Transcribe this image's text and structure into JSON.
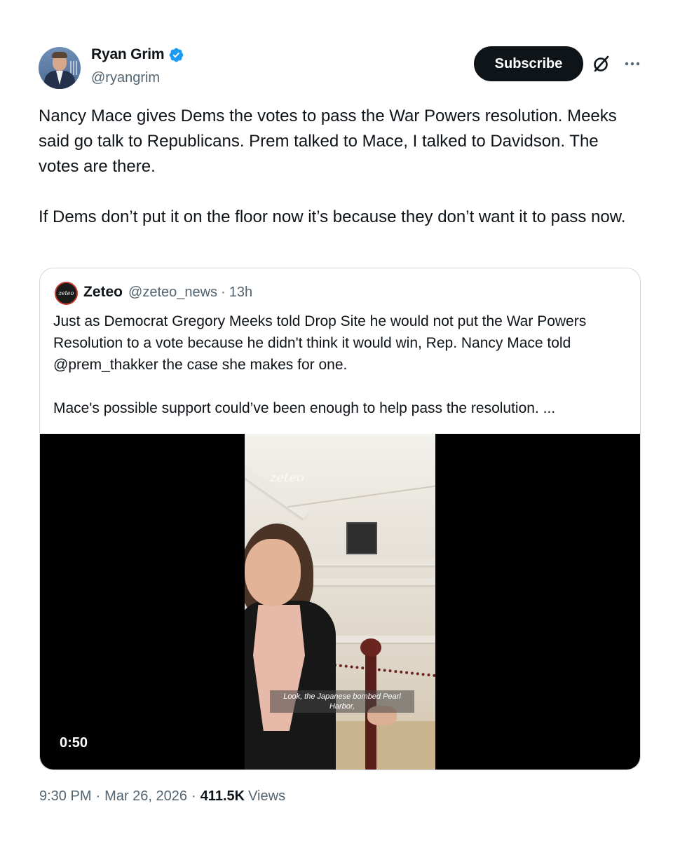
{
  "author": {
    "display_name": "Ryan Grim",
    "handle": "@ryangrim",
    "verified": true,
    "verified_color": "#1d9bf0"
  },
  "actions": {
    "subscribe_label": "Subscribe",
    "grok_icon": "grok-icon",
    "more_icon": "more-horizontal-icon"
  },
  "tweet": {
    "text": "Nancy Mace gives Dems the votes to pass the War Powers resolution. Meeks said go talk to Republicans. Prem talked to Mace, I talked to Davidson. The votes are there.\n\nIf Dems don’t put it on the floor now it’s because they don’t want it to pass now."
  },
  "quote": {
    "avatar_text": "zeteo",
    "name": "Zeteo",
    "handle": "@zeteo_news",
    "separator": "·",
    "time": "13h",
    "text": "Just as Democrat Gregory Meeks told Drop Site he would not put the War Powers Resolution to a vote because he didn't think it would win, Rep. Nancy Mace told @prem_thakker the case she makes for one.\n\nMace's possible support could’ve been enough to help pass the resolution.  ...",
    "video": {
      "watermark": "zeteo",
      "caption": "Look, the Japanese bombed Pearl Harbor,",
      "duration": "0:50"
    }
  },
  "footer": {
    "time": "9:30 PM",
    "separator": "·",
    "date": "Mar 26, 2026",
    "views_count": "411.5K",
    "views_label": "Views"
  }
}
